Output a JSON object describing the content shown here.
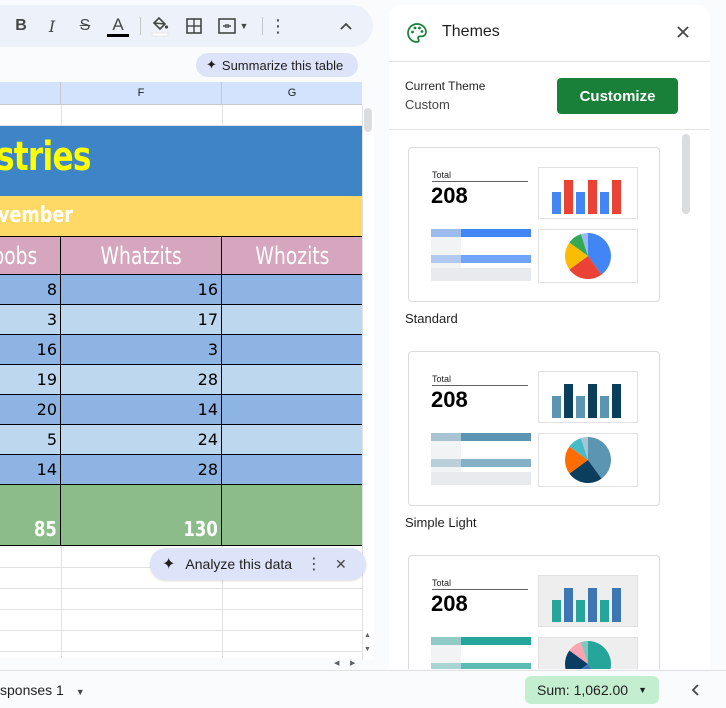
{
  "toolbar": {
    "bold_label": "B",
    "italic_label": "I",
    "strike_label": "S",
    "textcolor_label": "A",
    "text_color": "#000000"
  },
  "summarize": {
    "label": "Summarize this table"
  },
  "columns": [
    "F",
    "G"
  ],
  "sheet": {
    "title": "stries",
    "subtitle": "vember",
    "headers": [
      "bobs",
      "Whatzits",
      "Whozits"
    ],
    "rows": [
      [
        "8",
        "16",
        ""
      ],
      [
        "3",
        "17",
        ""
      ],
      [
        "16",
        "3",
        ""
      ],
      [
        "19",
        "28",
        ""
      ],
      [
        "20",
        "14",
        ""
      ],
      [
        "5",
        "24",
        ""
      ],
      [
        "14",
        "28",
        ""
      ]
    ],
    "totals": [
      "85",
      "130",
      ""
    ],
    "colors": {
      "title_band": "#3d85c6",
      "title_text": "#ffff00",
      "subtitle_band": "#ffd966",
      "header_band": "#d5a6bd",
      "row_dark": "#8eb4e3",
      "row_light": "#bdd7ee",
      "total_band": "#8cbc8a"
    }
  },
  "analyze": {
    "label": "Analyze this data"
  },
  "bottom": {
    "sheet_tab": "sponses 1",
    "sum": "Sum: 1,062.00"
  },
  "panel": {
    "title": "Themes",
    "current_label": "Current Theme",
    "current_value": "Custom",
    "customize_label": "Customize",
    "themes": [
      {
        "name": "Standard",
        "total_label": "Total",
        "total_value": "208",
        "colors": [
          "#4285f4",
          "#ea4335",
          "#fbbc04",
          "#34a853"
        ]
      },
      {
        "name": "Simple Light",
        "total_label": "Total",
        "total_value": "208",
        "colors": [
          "#5b95b2",
          "#0b3d5c",
          "#ff6d01",
          "#46bdc6"
        ]
      },
      {
        "name": "",
        "total_label": "Total",
        "total_value": "208",
        "colors": [
          "#26a69a",
          "#3d76b3",
          "#0a3d62",
          "#f8a5b1"
        ]
      }
    ]
  }
}
